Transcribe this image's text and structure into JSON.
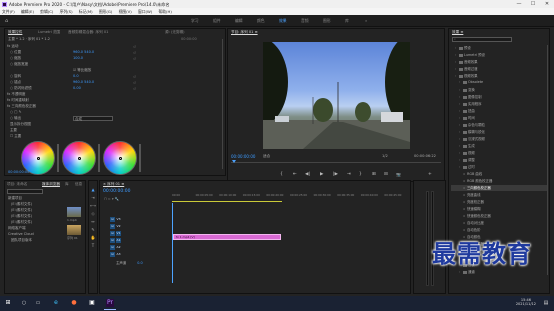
{
  "window": {
    "title": "Adobe Premiere Pro 2020 - C:\\用户\\Nasy\\文档\\Adobe\\Premiere Pro\\14.0\\未命名",
    "minimize": "—",
    "maximize": "☐",
    "close": "✕"
  },
  "menu": [
    "文件(F)",
    "编辑(E)",
    "剪辑(C)",
    "序列(S)",
    "标记(M)",
    "图形(G)",
    "视图(V)",
    "窗口(W)",
    "帮助(H)"
  ],
  "workspaces": {
    "home": "⌂",
    "tabs": [
      "学习",
      "组件",
      "编辑",
      "颜色",
      "效果",
      "音频",
      "图形",
      "库",
      "»"
    ],
    "active_index": 4
  },
  "effect_controls": {
    "tabs": [
      "效果控件",
      "Lumetri 范围",
      "音频剪辑混合器: 序列 01",
      "源: (无剪辑)"
    ],
    "header": "主要 * 1.2 · 序列 01 * 1.2",
    "timecode_head": "00:00:00",
    "rows": [
      {
        "label": "fx 运动",
        "value": ""
      },
      {
        "label": "○ 位置",
        "value": "960.0   540.0"
      },
      {
        "label": "○ 缩放",
        "value": "100.0"
      },
      {
        "label": "○ 缩放宽度",
        "value": ""
      },
      {
        "label": "",
        "value": "☑ 等比缩放"
      },
      {
        "label": "○ 旋转",
        "value": "0.0"
      },
      {
        "label": "○ 锚点",
        "value": "960.0   540.0"
      },
      {
        "label": "○ 防闪烁滤镜",
        "value": "0.00"
      },
      {
        "label": "fx 不透明度",
        "value": ""
      },
      {
        "label": "fx 时间重映射",
        "value": ""
      },
      {
        "label": "fx 三向颜色校正器",
        "value": ""
      },
      {
        "label": "○ □ ✎",
        "value": ""
      },
      {
        "label": "○ 输出",
        "value": "合成"
      },
      {
        "label": "  显示拆分视图",
        "value": ""
      },
      {
        "label": "  主要",
        "value": ""
      },
      {
        "label": "☐ 主要",
        "value": ""
      }
    ],
    "timecode_footer": "00:00:00:00"
  },
  "program_monitor": {
    "title": "节目: 序列 01 ≡",
    "timecode": "00:00:00:00",
    "fit": "适合",
    "fraction": "1/2",
    "duration": "00:00:06:22"
  },
  "transport": [
    "{",
    "⇤",
    "◀|",
    "▶",
    "|▶",
    "⇥",
    "}",
    "⊞",
    "⊟",
    "📷",
    "+"
  ],
  "effects_panel": {
    "title": "效果 ≡",
    "items": [
      {
        "label": "预设",
        "indent": 1,
        "type": "folder"
      },
      {
        "label": "Lumetri 预设",
        "indent": 1,
        "type": "folder"
      },
      {
        "label": "音频效果",
        "indent": 1,
        "type": "folder"
      },
      {
        "label": "音频过渡",
        "indent": 1,
        "type": "folder"
      },
      {
        "label": "视频效果",
        "indent": 1,
        "type": "folder"
      },
      {
        "label": "Obsolete",
        "indent": 2,
        "type": "folder"
      },
      {
        "label": "变换",
        "indent": 2,
        "type": "folder"
      },
      {
        "label": "图像控制",
        "indent": 2,
        "type": "folder"
      },
      {
        "label": "实用程序",
        "indent": 2,
        "type": "folder"
      },
      {
        "label": "扭曲",
        "indent": 2,
        "type": "folder"
      },
      {
        "label": "时间",
        "indent": 2,
        "type": "folder"
      },
      {
        "label": "杂色与颗粒",
        "indent": 2,
        "type": "folder"
      },
      {
        "label": "模糊与锐化",
        "indent": 2,
        "type": "folder"
      },
      {
        "label": "沉浸式视频",
        "indent": 2,
        "type": "folder"
      },
      {
        "label": "生成",
        "indent": 2,
        "type": "folder"
      },
      {
        "label": "视频",
        "indent": 2,
        "type": "folder"
      },
      {
        "label": "调整",
        "indent": 2,
        "type": "folder"
      },
      {
        "label": "过时",
        "indent": 2,
        "type": "folder"
      },
      {
        "label": "RGB 曲线",
        "indent": 3,
        "type": "effect"
      },
      {
        "label": "RGB 颜色校正器",
        "indent": 3,
        "type": "effect"
      },
      {
        "label": "三向颜色校正器",
        "indent": 3,
        "type": "effect"
      },
      {
        "label": "亮度曲线",
        "indent": 3,
        "type": "effect"
      },
      {
        "label": "亮度校正器",
        "indent": 3,
        "type": "effect"
      },
      {
        "label": "快速模糊",
        "indent": 3,
        "type": "effect"
      },
      {
        "label": "快速颜色校正器",
        "indent": 3,
        "type": "effect"
      },
      {
        "label": "自动对比度",
        "indent": 3,
        "type": "effect"
      },
      {
        "label": "自动色阶",
        "indent": 3,
        "type": "effect"
      },
      {
        "label": "自动颜色",
        "indent": 3,
        "type": "effect"
      },
      {
        "label": "视频限幅器",
        "indent": 3,
        "type": "effect"
      },
      {
        "label": "阴影/高光",
        "indent": 3,
        "type": "effect"
      },
      {
        "label": "过渡",
        "indent": 2,
        "type": "folder"
      },
      {
        "label": "透视",
        "indent": 2,
        "type": "folder"
      },
      {
        "label": "通道",
        "indent": 2,
        "type": "folder"
      }
    ],
    "selected_index": 20
  },
  "project_panel": {
    "tabs": [
      "项目: 未命名",
      "媒体浏览器",
      "库",
      "信息",
      "»"
    ],
    "items": [
      "新建项目",
      "(E:\\素材文件)",
      "(E:\\素材文件)",
      "(E:\\素材文件)",
      "(E:\\素材文件)",
      "网络客户端",
      "Creative Cloud",
      "团队项目版本"
    ],
    "thumb_labels": [
      "1.mp4",
      "序列 01"
    ]
  },
  "timeline": {
    "title": "× 序列 01 ≡",
    "timecode": "00:00:00:00",
    "ruler": [
      "00:00",
      "00:00:05:00",
      "00:00:10:00",
      "00:00:15:00",
      "00:00:20:00",
      "00:00:25:00",
      "00:00:30:00",
      "00:00:35:00",
      "00:00:40:00",
      "00:00:45:00"
    ],
    "tracks": [
      "V3",
      "V2",
      "V1",
      "A1",
      "A2",
      "A3",
      "主声道"
    ],
    "master_value": "0.0",
    "clip_label": "fx 1.mp4 [V]"
  },
  "watermark": "最需教育",
  "taskbar": {
    "time": "15:46",
    "date": "2021/11/12"
  },
  "colors": {
    "accent": "#4da3ff",
    "clip": "#d96ad4",
    "timecode": "#3d9bff"
  }
}
